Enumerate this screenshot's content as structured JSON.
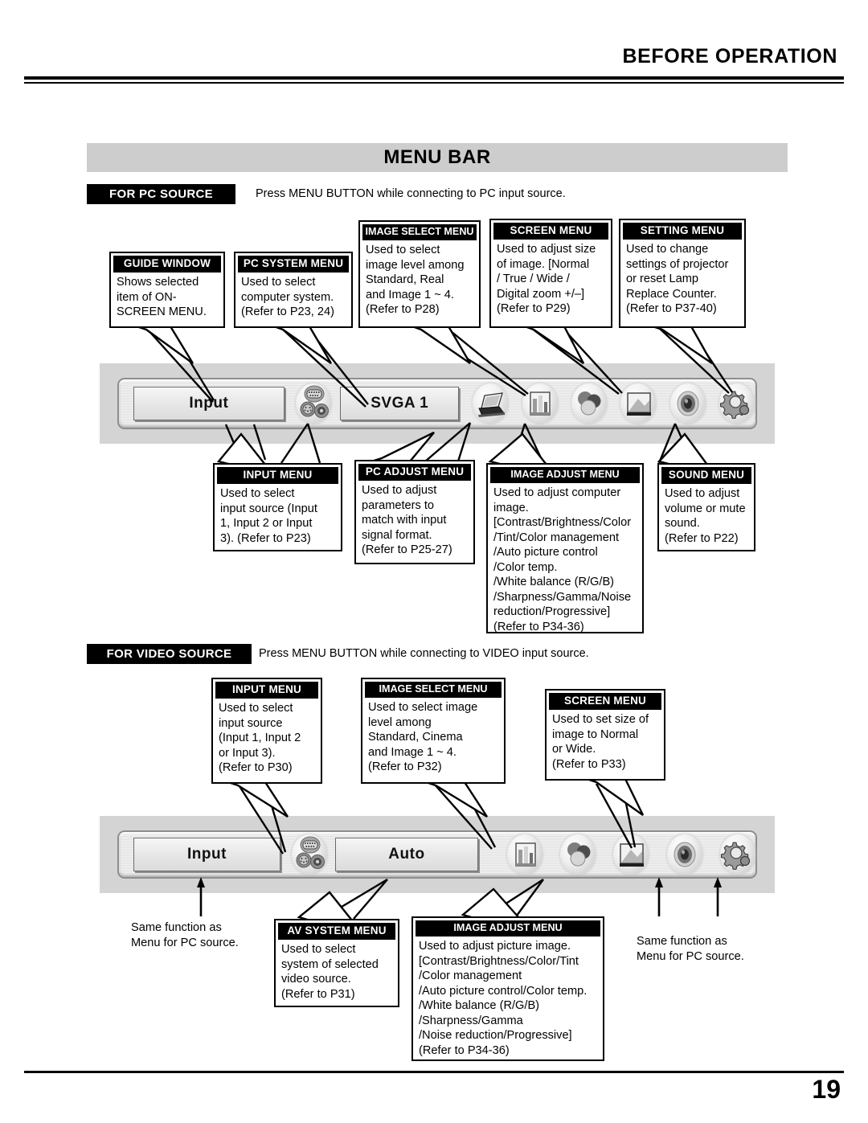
{
  "header": {
    "chapter_title": "BEFORE OPERATION",
    "page_number": "19"
  },
  "section": {
    "band_title": "MENU BAR"
  },
  "pc_source": {
    "tag": "FOR PC SOURCE",
    "note": "Press MENU BUTTON while connecting to PC input source.",
    "callouts_top": [
      {
        "title": "GUIDE WINDOW",
        "body": "Shows selected\nitem of ON-\nSCREEN MENU."
      },
      {
        "title": "PC SYSTEM MENU",
        "body": "Used to select\ncomputer system.\n(Refer to P23, 24)"
      },
      {
        "title": "IMAGE SELECT MENU",
        "body": "Used to select\nimage level among\nStandard, Real\nand Image 1 ~ 4.\n(Refer to P28)"
      },
      {
        "title": "SCREEN MENU",
        "body": "Used to adjust size\nof image.  [Normal\n/ True / Wide /\nDigital zoom +/–]\n(Refer to P29)"
      },
      {
        "title": "SETTING MENU",
        "body": "Used to change\nsettings of projector\nor reset Lamp\nReplace Counter.\n(Refer to P37-40)"
      }
    ],
    "callouts_bottom": [
      {
        "title": "INPUT MENU",
        "body": "Used to select\ninput source (Input\n1, Input 2 or Input\n3). (Refer to P23)"
      },
      {
        "title": "PC ADJUST MENU",
        "body": "Used to adjust\nparameters to\nmatch with input\nsignal format.\n(Refer to P25-27)"
      },
      {
        "title": "IMAGE ADJUST MENU",
        "body": "Used to adjust computer\nimage.\n[Contrast/Brightness/Color\n/Tint/Color management\n/Auto picture control\n/Color temp.\n/White balance (R/G/B)\n/Sharpness/Gamma/Noise\nreduction/Progressive]\n(Refer to P34-36)"
      },
      {
        "title": "SOUND MENU",
        "body": "Used to adjust\nvolume or mute\nsound.\n(Refer to P22)"
      }
    ],
    "osd": {
      "input_button": "Input",
      "system_button": "SVGA 1",
      "icons": [
        "connector-icon",
        "laptop-pc-adjust-icon",
        "image-select-icon",
        "image-adjust-icon",
        "screen-icon",
        "sound-icon",
        "setting-gear-icon"
      ]
    }
  },
  "video_source": {
    "tag": "FOR VIDEO SOURCE",
    "note": "Press MENU BUTTON while connecting to VIDEO input source.",
    "callouts_top": [
      {
        "title": "INPUT MENU",
        "body": "Used to select\ninput source\n(Input 1, Input 2\nor Input 3).\n(Refer to P30)"
      },
      {
        "title": "IMAGE SELECT MENU",
        "body": "Used to select image\nlevel among\nStandard, Cinema\nand Image 1 ~ 4.\n(Refer to P32)"
      },
      {
        "title": "SCREEN MENU",
        "body": "Used to set size of\nimage to Normal\nor Wide.\n(Refer to P33)"
      }
    ],
    "callouts_bottom": [
      {
        "title": "AV SYSTEM MENU",
        "body": "Used to select\nsystem of selected\nvideo source.\n(Refer to P31)"
      },
      {
        "title": "IMAGE ADJUST MENU",
        "body": "Used to adjust picture image.\n[Contrast/Brightness/Color/Tint\n/Color management\n/Auto picture control/Color temp.\n/White balance (R/G/B)\n/Sharpness/Gamma\n/Noise reduction/Progressive]\n(Refer to P34-36)"
      }
    ],
    "plain_notes": [
      "Same function as\nMenu for PC source.",
      "Same function as\nMenu for PC source."
    ],
    "osd": {
      "input_button": "Input",
      "system_button": "Auto",
      "icons": [
        "connector-icon",
        "image-select-icon",
        "image-adjust-icon",
        "screen-icon",
        "sound-icon",
        "setting-gear-icon"
      ]
    }
  },
  "colors": {
    "band_gray": "#cdcdcd",
    "panel_gray": "#d4d4d4",
    "ink": "#000000"
  }
}
